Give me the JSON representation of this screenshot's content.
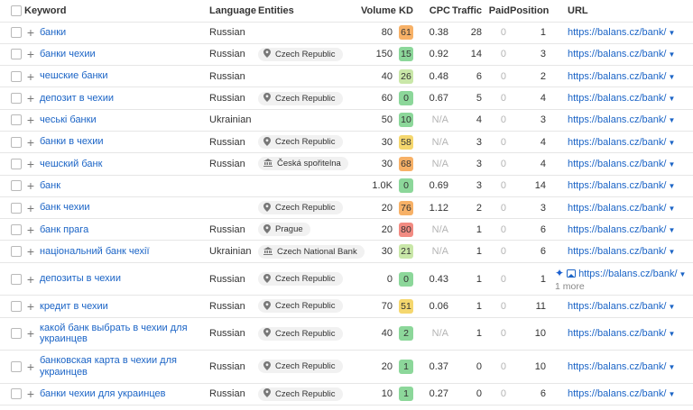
{
  "colors": {
    "link": "#1b64c6",
    "kd_green": "#8cd79a",
    "kd_light_green": "#c9e7a8",
    "kd_yellow": "#f5d76e",
    "kd_orange": "#f7b167",
    "kd_red": "#f28b82"
  },
  "header": {
    "keyword": "Keyword",
    "language": "Language",
    "entities": "Entities",
    "volume": "Volume",
    "kd": "KD",
    "cpc": "CPC",
    "traffic": "Traffic",
    "paid": "Paid",
    "position": "Position",
    "url": "URL"
  },
  "rows": [
    {
      "keyword": "банки",
      "language": "Russian",
      "entity": "",
      "entity_icon": "",
      "volume": "80",
      "kd": "61",
      "kd_color": "#f7b167",
      "cpc": "0.38",
      "traffic": "28",
      "paid": "0",
      "position": "1",
      "url": "https://balans.cz/bank/"
    },
    {
      "keyword": "банки чехии",
      "language": "Russian",
      "entity": "Czech Republic",
      "entity_icon": "location-pin-icon",
      "volume": "150",
      "kd": "15",
      "kd_color": "#8cd79a",
      "cpc": "0.92",
      "traffic": "14",
      "paid": "0",
      "position": "3",
      "url": "https://balans.cz/bank/"
    },
    {
      "keyword": "чешские банки",
      "language": "Russian",
      "entity": "",
      "entity_icon": "",
      "volume": "40",
      "kd": "26",
      "kd_color": "#c9e7a8",
      "cpc": "0.48",
      "traffic": "6",
      "paid": "0",
      "position": "2",
      "url": "https://balans.cz/bank/"
    },
    {
      "keyword": "депозит в чехии",
      "language": "Russian",
      "entity": "Czech Republic",
      "entity_icon": "location-pin-icon",
      "volume": "60",
      "kd": "0",
      "kd_color": "#8cd79a",
      "cpc": "0.67",
      "traffic": "5",
      "paid": "0",
      "position": "4",
      "url": "https://balans.cz/bank/"
    },
    {
      "keyword": "чеські банки",
      "language": "Ukrainian",
      "entity": "",
      "entity_icon": "",
      "volume": "50",
      "kd": "10",
      "kd_color": "#8cd79a",
      "cpc": "N/A",
      "traffic": "4",
      "paid": "0",
      "position": "3",
      "url": "https://balans.cz/bank/"
    },
    {
      "keyword": "банки в чехии",
      "language": "Russian",
      "entity": "Czech Republic",
      "entity_icon": "location-pin-icon",
      "volume": "30",
      "kd": "58",
      "kd_color": "#f5d76e",
      "cpc": "N/A",
      "traffic": "3",
      "paid": "0",
      "position": "4",
      "url": "https://balans.cz/bank/"
    },
    {
      "keyword": "чешский банк",
      "language": "Russian",
      "entity": "Česká spořitelna",
      "entity_icon": "bank-building-icon",
      "volume": "30",
      "kd": "68",
      "kd_color": "#f7b167",
      "cpc": "N/A",
      "traffic": "3",
      "paid": "0",
      "position": "4",
      "url": "https://balans.cz/bank/"
    },
    {
      "keyword": "банк",
      "language": "",
      "entity": "",
      "entity_icon": "",
      "volume": "1.0K",
      "kd": "0",
      "kd_color": "#8cd79a",
      "cpc": "0.69",
      "traffic": "3",
      "paid": "0",
      "position": "14",
      "url": "https://balans.cz/bank/"
    },
    {
      "keyword": "банк чехии",
      "language": "",
      "entity": "Czech Republic",
      "entity_icon": "location-pin-icon",
      "volume": "20",
      "kd": "76",
      "kd_color": "#f7b167",
      "cpc": "1.12",
      "traffic": "2",
      "paid": "0",
      "position": "3",
      "url": "https://balans.cz/bank/"
    },
    {
      "keyword": "банк прага",
      "language": "Russian",
      "entity": "Prague",
      "entity_icon": "location-pin-icon",
      "volume": "20",
      "kd": "80",
      "kd_color": "#f28b82",
      "cpc": "N/A",
      "traffic": "1",
      "paid": "0",
      "position": "6",
      "url": "https://balans.cz/bank/"
    },
    {
      "keyword": "національний банк чехії",
      "language": "Ukrainian",
      "entity": "Czech National Bank",
      "entity_icon": "bank-building-icon",
      "volume": "30",
      "kd": "21",
      "kd_color": "#c9e7a8",
      "cpc": "N/A",
      "traffic": "1",
      "paid": "0",
      "position": "6",
      "url": "https://balans.cz/bank/"
    },
    {
      "keyword": "депозиты в чехии",
      "language": "Russian",
      "entity": "Czech Republic",
      "entity_icon": "location-pin-icon",
      "volume": "0",
      "kd": "0",
      "kd_color": "#8cd79a",
      "cpc": "0.43",
      "traffic": "1",
      "paid": "0",
      "position": "1",
      "url": "https://balans.cz/bank/",
      "more": "1 more",
      "special": true
    },
    {
      "keyword": "кредит в чехии",
      "language": "Russian",
      "entity": "Czech Republic",
      "entity_icon": "location-pin-icon",
      "volume": "70",
      "kd": "51",
      "kd_color": "#f5d76e",
      "cpc": "0.06",
      "traffic": "1",
      "paid": "0",
      "position": "11",
      "url": "https://balans.cz/bank/"
    },
    {
      "keyword": "какой банк выбрать в чехии для украинцев",
      "language": "Russian",
      "entity": "Czech Republic",
      "entity_icon": "location-pin-icon",
      "volume": "40",
      "kd": "2",
      "kd_color": "#8cd79a",
      "cpc": "N/A",
      "traffic": "1",
      "paid": "0",
      "position": "10",
      "url": "https://balans.cz/bank/",
      "tall": true
    },
    {
      "keyword": "банковская карта в чехии для украинцев",
      "language": "Russian",
      "entity": "Czech Republic",
      "entity_icon": "location-pin-icon",
      "volume": "20",
      "kd": "1",
      "kd_color": "#8cd79a",
      "cpc": "0.37",
      "traffic": "0",
      "paid": "0",
      "position": "10",
      "url": "https://balans.cz/bank/",
      "tall": true
    },
    {
      "keyword": "банки чехии для украинцев",
      "language": "Russian",
      "entity": "Czech Republic",
      "entity_icon": "location-pin-icon",
      "volume": "10",
      "kd": "1",
      "kd_color": "#8cd79a",
      "cpc": "0.27",
      "traffic": "0",
      "paid": "0",
      "position": "6",
      "url": "https://balans.cz/bank/"
    }
  ]
}
